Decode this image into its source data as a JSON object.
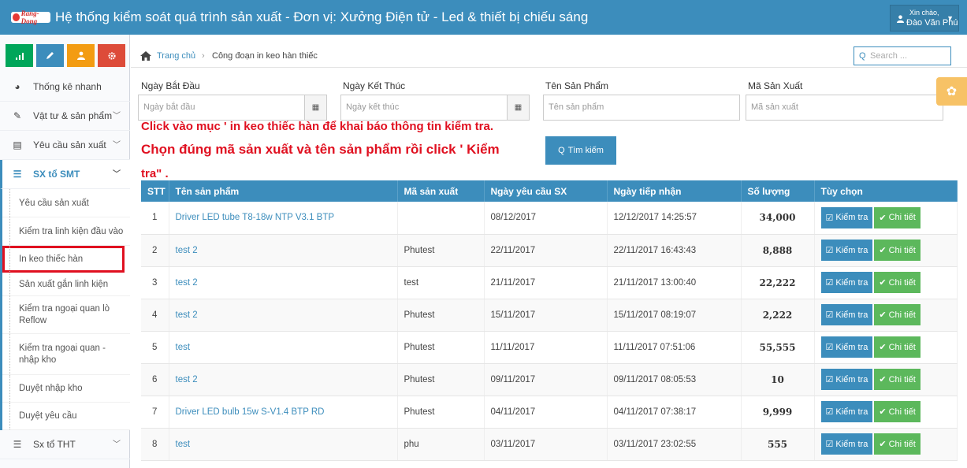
{
  "header": {
    "logo_text": "Rang-Dong",
    "title": "Hệ thống kiểm soát quá trình sản xuất - Đơn vị: Xưởng Điện tử - Led & thiết bị chiếu sáng",
    "user_greeting": "Xin chào,",
    "user_name": "Đào Văn Phú"
  },
  "sidebar": {
    "quick_buttons": [
      {
        "icon": "bar-chart-icon",
        "color": "#00a65a"
      },
      {
        "icon": "pencil-icon",
        "color": "#3c8dbc"
      },
      {
        "icon": "users-icon",
        "color": "#f39c12"
      },
      {
        "icon": "cogs-icon",
        "color": "#dd4b39"
      }
    ],
    "items": [
      {
        "label": "Thống kê nhanh",
        "icon": "dashboard-icon"
      },
      {
        "label": "Vật tư & sản phẩm",
        "icon": "edit-icon"
      },
      {
        "label": "Yêu cầu sản xuất",
        "icon": "list-icon"
      },
      {
        "label": "SX tổ SMT",
        "icon": "list-ol-icon"
      },
      {
        "label": "Sx tổ THT",
        "icon": "list-ol-icon"
      }
    ],
    "sub_items": [
      "Yêu cầu sản xuất",
      "Kiểm tra linh kiện đầu vào",
      "In keo thiếc hàn",
      "Sản xuất gắn linh kiện",
      "Kiểm tra ngoại quan lò Reflow",
      "Kiểm tra ngoại quan - nhập kho",
      "Duyệt nhập kho",
      "Duyệt yêu cầu"
    ],
    "highlighted_sub_item": "In keo thiếc hàn"
  },
  "breadcrumb": {
    "home": "Trang chủ",
    "current": "Công đoạn in keo hàn thiếc"
  },
  "search": {
    "placeholder": "Search ..."
  },
  "filters": {
    "start_label": "Ngày Bắt Đầu",
    "start_placeholder": "Ngày bắt đầu",
    "end_label": "Ngày Kết Thúc",
    "end_placeholder": "Ngày kết thúc",
    "product_label": "Tên Sản Phẩm",
    "product_placeholder": "Tên sản phẩm",
    "code_label": "Mã Sản Xuất",
    "code_placeholder": "Mã sản xuất",
    "search_button": "Tìm kiếm"
  },
  "annotation": {
    "line1": "Click vào mục ' in keo thiếc hàn để khai báo thông tin kiểm tra.",
    "line2": "Chọn đúng mã sản xuất và tên sản phẩm rồi click ' Kiểm",
    "line3": "tra\"   ."
  },
  "table": {
    "columns": [
      "STT",
      "Tên sản phẩm",
      "Mã sản xuất",
      "Ngày yêu cầu SX",
      "Ngày tiếp nhận",
      "Số lượng",
      "Tùy chọn"
    ],
    "check_label": "Kiểm tra",
    "detail_label": "Chi tiết",
    "rows": [
      {
        "stt": "1",
        "name": "Driver LED tube T8-18w NTP V3.1 BTP",
        "code": "",
        "req_date": "08/12/2017",
        "recv_date": "12/12/2017 14:25:57",
        "qty": "34,000"
      },
      {
        "stt": "2",
        "name": "test 2",
        "code": "Phutest",
        "req_date": "22/11/2017",
        "recv_date": "22/11/2017 16:43:43",
        "qty": "8,888"
      },
      {
        "stt": "3",
        "name": "test 2",
        "code": "test",
        "req_date": "21/11/2017",
        "recv_date": "21/11/2017 13:00:40",
        "qty": "22,222"
      },
      {
        "stt": "4",
        "name": "test 2",
        "code": "Phutest",
        "req_date": "15/11/2017",
        "recv_date": "15/11/2017 08:19:07",
        "qty": "2,222"
      },
      {
        "stt": "5",
        "name": "test",
        "code": "Phutest",
        "req_date": "11/11/2017",
        "recv_date": "11/11/2017 07:51:06",
        "qty": "55,555"
      },
      {
        "stt": "6",
        "name": "test 2",
        "code": "Phutest",
        "req_date": "09/11/2017",
        "recv_date": "09/11/2017 08:05:53",
        "qty": "10"
      },
      {
        "stt": "7",
        "name": "Driver LED bulb 15w S-V1.4 BTP RD",
        "code": "Phutest",
        "req_date": "04/11/2017",
        "recv_date": "04/11/2017 07:38:17",
        "qty": "9,999"
      },
      {
        "stt": "8",
        "name": "test",
        "code": "phu",
        "req_date": "03/11/2017",
        "recv_date": "03/11/2017 23:02:55",
        "qty": "555"
      }
    ]
  },
  "colors": {
    "primary": "#3c8dbc",
    "success": "#5cb85c",
    "annotation": "#e01020"
  }
}
